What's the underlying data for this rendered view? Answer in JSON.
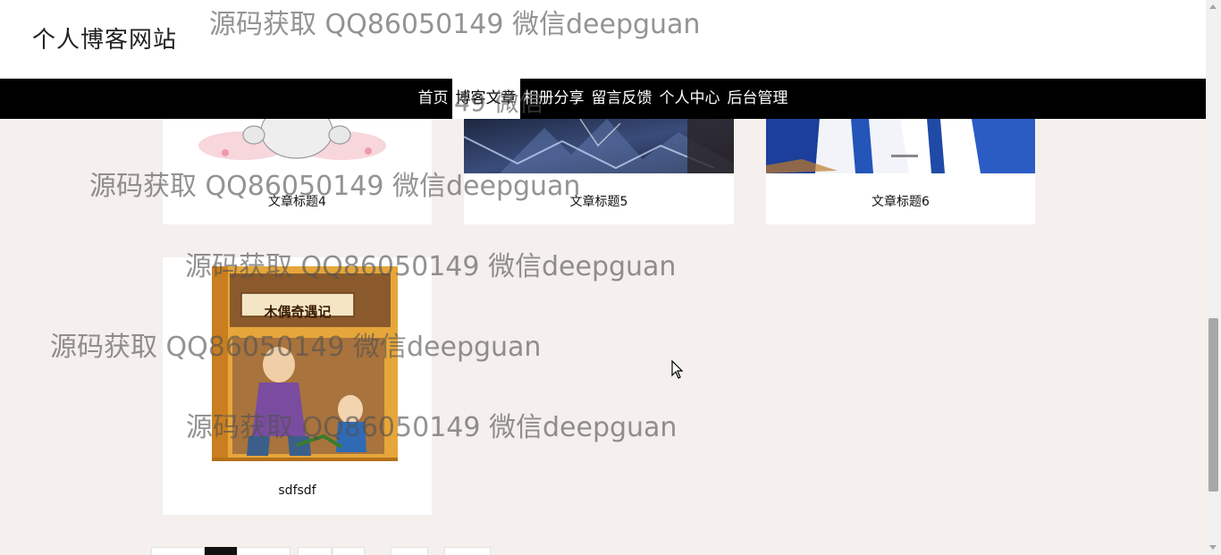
{
  "site": {
    "title": "个人博客网站"
  },
  "nav": {
    "items": [
      {
        "label": "首页",
        "active": false
      },
      {
        "label": "博客文章",
        "active": true
      },
      {
        "label": "相册分享",
        "active": false
      },
      {
        "label": "留言反馈",
        "active": false
      },
      {
        "label": "个人中心",
        "active": false
      },
      {
        "label": "后台管理",
        "active": false
      }
    ]
  },
  "articles": [
    {
      "title": "文章标题4"
    },
    {
      "title": "文章标题5"
    },
    {
      "title": "文章标题6"
    },
    {
      "title": "sdfsdf",
      "cover_text": "木偶奇遇记"
    }
  ],
  "watermark": {
    "text": "源码获取 QQ86050149 微信deepguan",
    "partial": "49 微信"
  },
  "colors": {
    "nav_bg": "#000000",
    "page_bg": "#f5f0ed",
    "header_bg": "#ffffff"
  }
}
